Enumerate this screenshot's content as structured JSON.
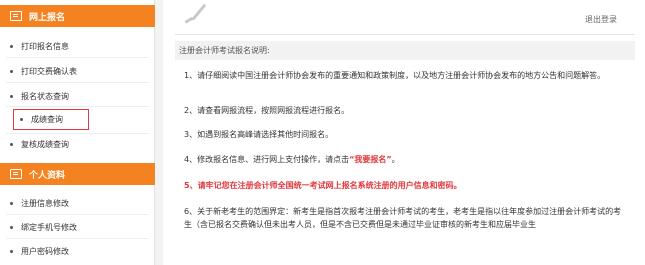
{
  "sidebar": {
    "section1_title": "网上报名",
    "section1_items": [
      "打印报名信息",
      "打印交费确认表",
      "报名状态查询",
      "成绩查询",
      "复核成绩查询"
    ],
    "section2_title": "个人资料",
    "section2_items": [
      "注册信息修改",
      "绑定手机号修改",
      "用户密码修改"
    ]
  },
  "header": {
    "logout_label": "退出登录"
  },
  "notice": {
    "title": "注册会计师考试报名说明:",
    "p1": "1、请仔细阅读中国注册会计师协会发布的重要通知和政策制度，以及地方注册会计师协会发布的地方公告和问题解答。",
    "p2": "2、请查看网报流程，按照网报流程进行报名。",
    "p3": "3、如遇到报名高峰请选择其他时间报名。",
    "p4_prefix": "4、修改报名信息、进行网上支付操作，请点击",
    "p4_link": "“我要报名”",
    "p4_suffix": "。",
    "p5": "5、请牢记您在注册会计师全国统一考试网上报名系统注册的用户信息和密码。",
    "p6": "6、关于新老考生的范围界定：新考生是指首次报考注册会计师考试的考生，老考生是指以往年度参加过注册会计师考试的考生（含已报名交费确认但未出考人员，但是不含已交费但是未通过毕业证审核的新考生和应届毕业生"
  },
  "colors": {
    "accent": "#f58220",
    "highlight": "#e0393e"
  }
}
